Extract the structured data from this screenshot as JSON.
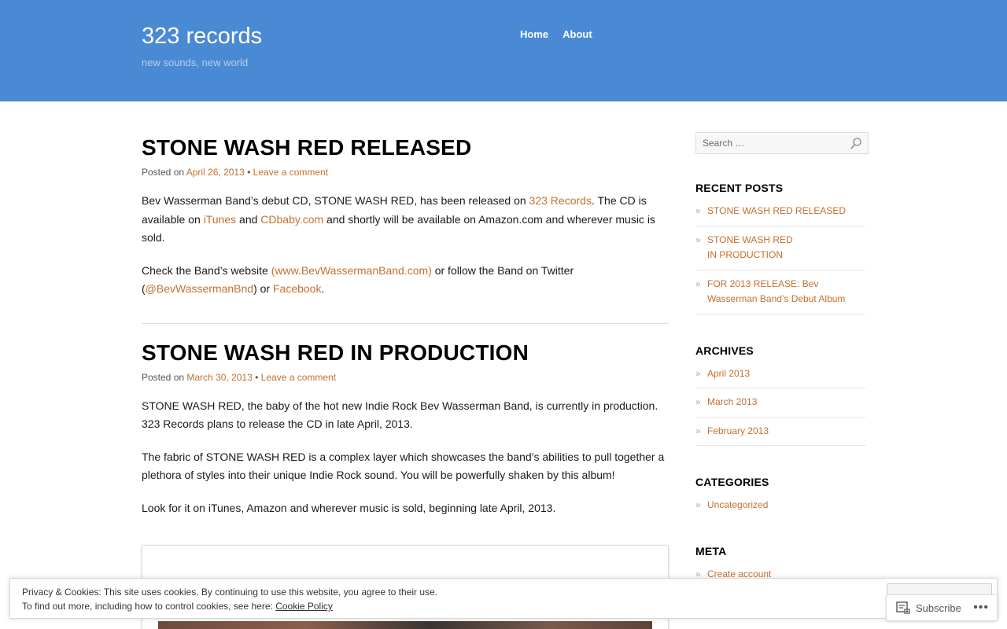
{
  "header": {
    "site_title": "323 records",
    "tagline": "new sounds, new world",
    "nav": [
      {
        "label": "Home"
      },
      {
        "label": "About"
      }
    ]
  },
  "posts": [
    {
      "title": "STONE WASH RED RELEASED",
      "meta_prefix": "Posted on",
      "date": "April 26, 2013",
      "separator": "•",
      "comment_link": "Leave a comment",
      "p1": {
        "t1": "Bev Wasserman Band’s debut CD, STONE WASH RED, has been released on ",
        "link1": "323 Records",
        "t2": ". The CD is available on ",
        "link2": "iTunes",
        "t3": " and ",
        "link3": "CDbaby.com",
        "t4": " and shortly will be available on Amazon.com and wherever music is sold."
      },
      "p2": {
        "t1": "Check the Band’s website ",
        "link1": "(www.BevWassermanBand.com)",
        "t2": " or follow the Band on Twitter (",
        "link2": "@BevWassermanBnd",
        "t3": ") or ",
        "link3": "Facebook",
        "t4": "."
      }
    },
    {
      "title": "STONE WASH RED IN PRODUCTION",
      "meta_prefix": "Posted on",
      "date": "March 30, 2013",
      "separator": "•",
      "comment_link": "Leave a comment",
      "p1": "STONE WASH RED, the baby of the hot new Indie Rock Bev Wasserman Band, is currently in production. 323 Records plans to release the CD in late April, 2013.",
      "p2": "The fabric of STONE WASH RED is a complex layer which showcases the band’s abilities to pull together a plethora of styles into their unique Indie Rock sound. You will be powerfully shaken by this album!",
      "p3": "Look for it on iTunes, Amazon and wherever music is sold, beginning late April, 2013."
    }
  ],
  "sidebar": {
    "search_placeholder": "Search …",
    "recent_posts_title": "RECENT POSTS",
    "recent_posts": [
      {
        "label": "STONE WASH RED RELEASED"
      },
      {
        "label": "STONE WASH RED IN PRODUCTION"
      },
      {
        "label": "FOR 2013 RELEASE: Bev Wasserman Band’s Debut Album"
      }
    ],
    "archives_title": "ARCHIVES",
    "archives": [
      {
        "label": "April 2013"
      },
      {
        "label": "March 2013"
      },
      {
        "label": "February 2013"
      }
    ],
    "categories_title": "CATEGORIES",
    "categories": [
      {
        "label": "Uncategorized"
      }
    ],
    "meta_title": "META",
    "meta": [
      {
        "label": "Create account"
      }
    ],
    "bullet": "»"
  },
  "cookie_bar": {
    "line1": "Privacy & Cookies: This site uses cookies. By continuing to use this website, you agree to their use.",
    "line2_prefix": "To find out more, including how to control cookies, see here: ",
    "policy_link": "Cookie Policy"
  },
  "subscribe": {
    "label": "Subscribe",
    "more": "•••"
  },
  "colors": {
    "header_bg": "#4a8ad4",
    "link": "#c4702f"
  }
}
